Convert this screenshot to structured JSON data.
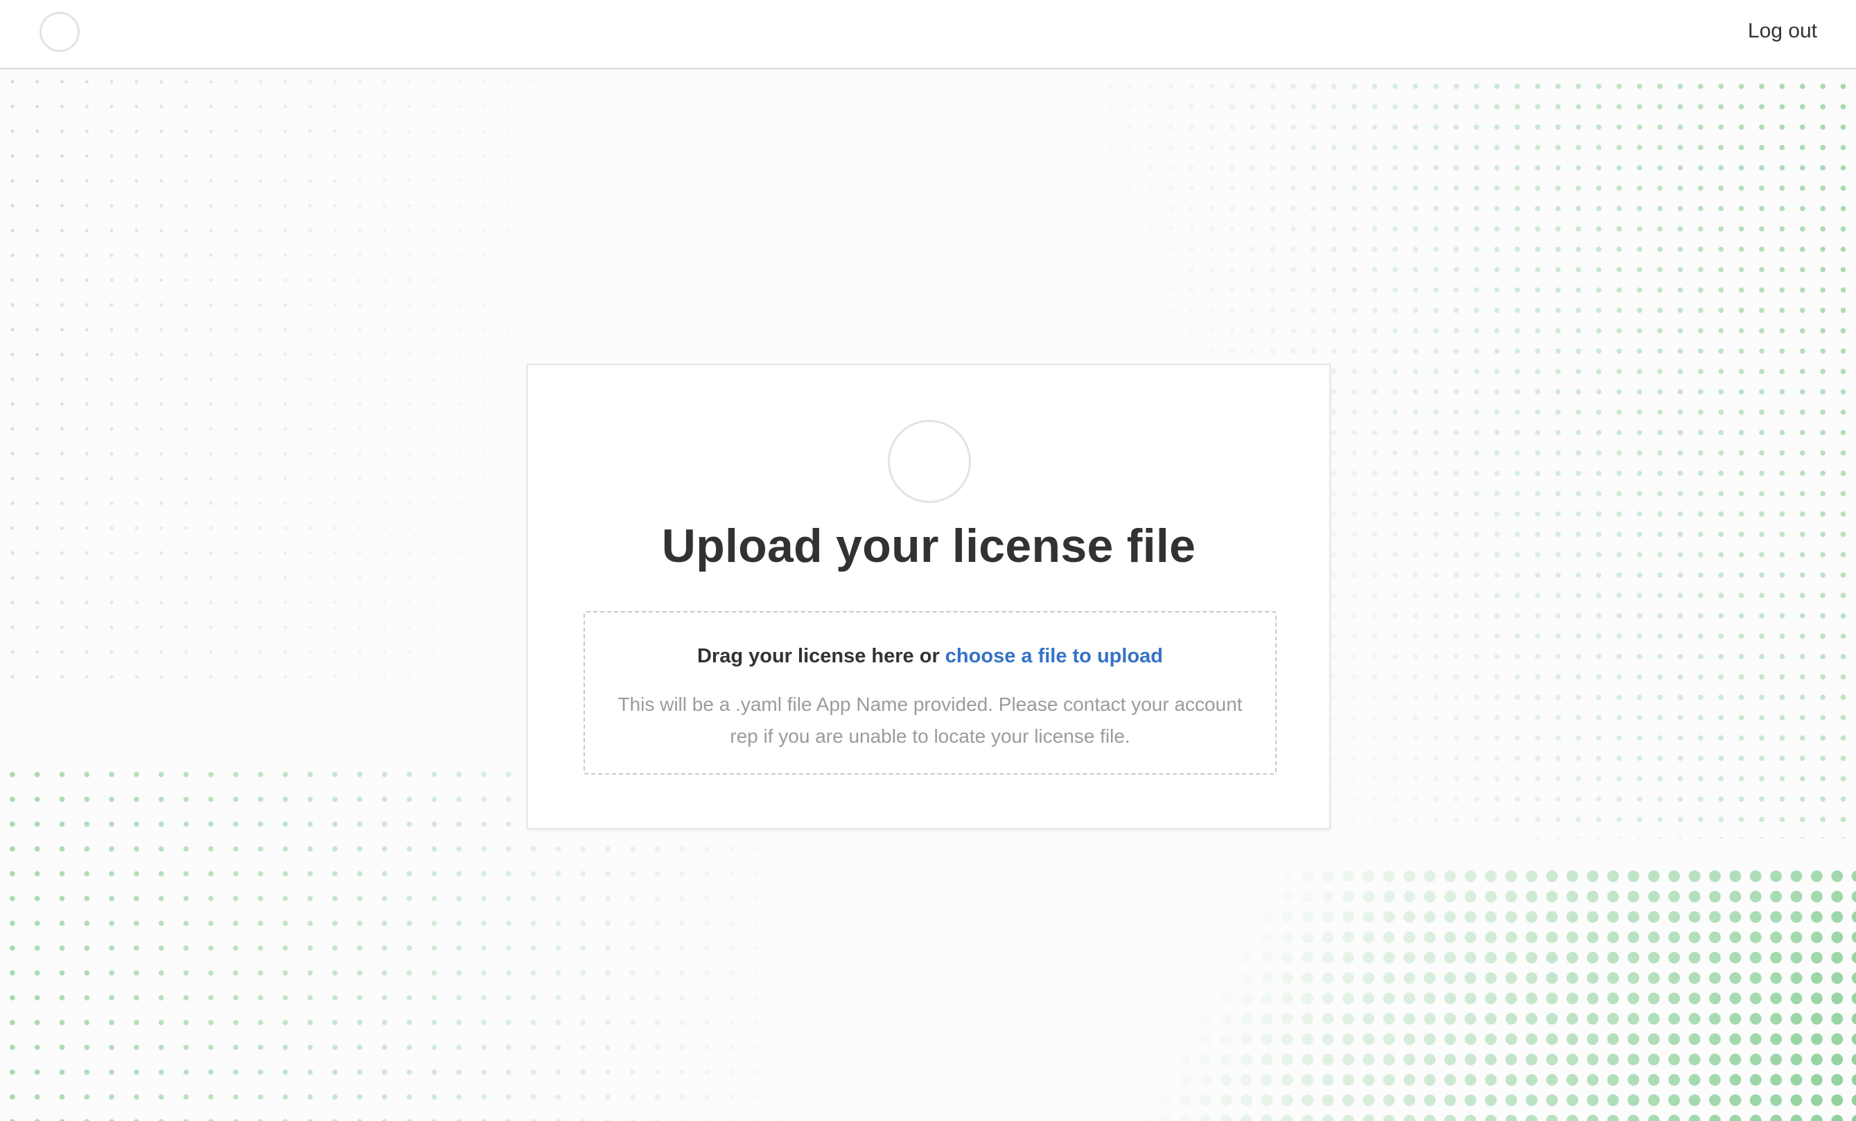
{
  "header": {
    "logout_label": "Log out"
  },
  "upload": {
    "title": "Upload your license file",
    "drag_text": "Drag your license here or ",
    "choose_link": "choose a file to upload",
    "help_text": "This will be a .yaml file App Name provided. Please contact your account rep if you are unable to locate your license file."
  },
  "colors": {
    "link": "#3572c6",
    "title": "#323232",
    "help": "#9b9b9b",
    "dots": "#8ccd96"
  }
}
